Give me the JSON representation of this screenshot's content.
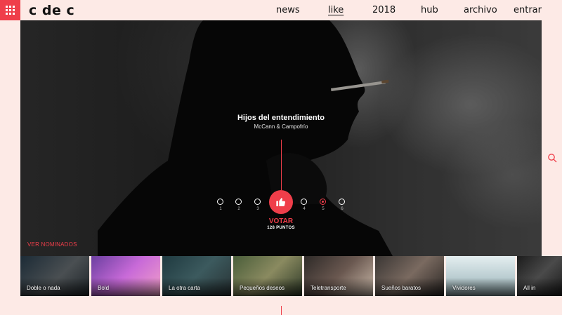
{
  "logo": "c de c",
  "nav": [
    {
      "label": "news"
    },
    {
      "label": "like"
    },
    {
      "label": "2018"
    },
    {
      "label": "hub"
    },
    {
      "label": "archivo"
    },
    {
      "label": "entrar"
    }
  ],
  "active_nav": "like",
  "feature": {
    "title": "Hijos del entendimiento",
    "subtitle": "McCann & Campofrío",
    "vote_label": "VOTAR",
    "points": "128 PUNTOS",
    "ratings": [
      "1",
      "2",
      "3",
      "4",
      "5",
      "6"
    ],
    "selected_rating": "5"
  },
  "ver_nominados": "VER NOMINADOS",
  "nominees": [
    {
      "label": "Doble o nada"
    },
    {
      "label": "Bold"
    },
    {
      "label": "La otra carta"
    },
    {
      "label": "Pequeños deseos"
    },
    {
      "label": "Teletransporte"
    },
    {
      "label": "Sueños baratos"
    },
    {
      "label": "Vividores"
    },
    {
      "label": "All in"
    }
  ],
  "colors": {
    "accent": "#ef3e4a",
    "page_bg": "#fdeae6"
  },
  "icons": [
    "grid-menu-icon",
    "thumbs-up-icon",
    "search-icon"
  ]
}
